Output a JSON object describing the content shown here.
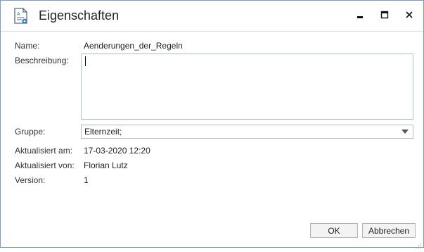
{
  "window": {
    "title": "Eigenschaften",
    "icons": {
      "app": "document-properties-icon",
      "minimize": "minimize-icon",
      "maximize": "maximize-icon",
      "close": "close-icon"
    }
  },
  "form": {
    "name_label": "Name:",
    "name_value": "Aenderungen_der_Regeln",
    "description_label": "Beschreibung:",
    "description_value": "",
    "group_label": "Gruppe:",
    "group_value": "Elternzeit;",
    "updated_at_label": "Aktualisiert am:",
    "updated_at_value": "17-03-2020 12:20",
    "updated_by_label": "Aktualisiert von:",
    "updated_by_value": "Florian Lutz",
    "version_label": "Version:",
    "version_value": "1"
  },
  "buttons": {
    "ok": "OK",
    "cancel": "Abbrechen"
  },
  "colors": {
    "window_border": "#7a9bc4",
    "input_border": "#a9c4de",
    "button_bg": "#f3f3f3"
  }
}
